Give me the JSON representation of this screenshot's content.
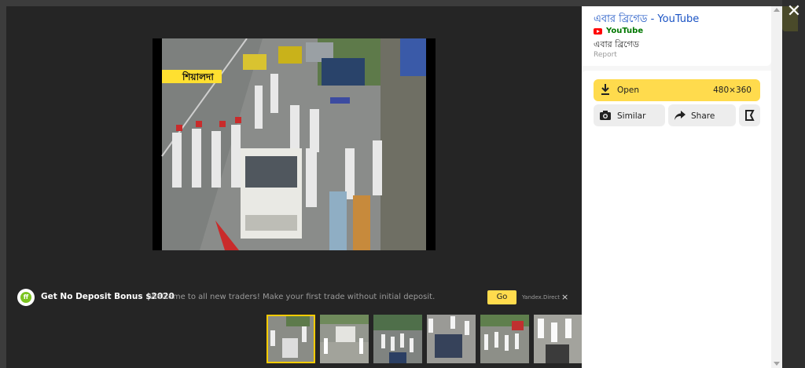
{
  "viewer": {
    "close_icon": "close-icon",
    "main_image": {
      "overlay_label": "শিয়ালদা",
      "caption_hint": ""
    }
  },
  "ad": {
    "logo_text": "ff",
    "title": "Get No Deposit Bonus $2020",
    "description": "Welcome to all new traders! Make your first trade without initial deposit.",
    "go_label": "Go",
    "source_label": "Yandex.Direct",
    "close_label": "×"
  },
  "thumbnails": [
    {
      "selected": true
    },
    {
      "selected": false
    },
    {
      "selected": false
    },
    {
      "selected": false
    },
    {
      "selected": false
    },
    {
      "selected": false
    }
  ],
  "sidebar": {
    "result_title": "এবার ব্রিগেড - YouTube",
    "source_name": "YouTube",
    "subtitle": "এবার ব্রিগেড",
    "report_label": "Report",
    "open_label": "Open",
    "dimensions": "480×360",
    "similar_label": "Similar",
    "share_label": "Share"
  },
  "colors": {
    "accent": "#ffdb4d",
    "link": "#1a53c4",
    "source_green": "#007700"
  }
}
